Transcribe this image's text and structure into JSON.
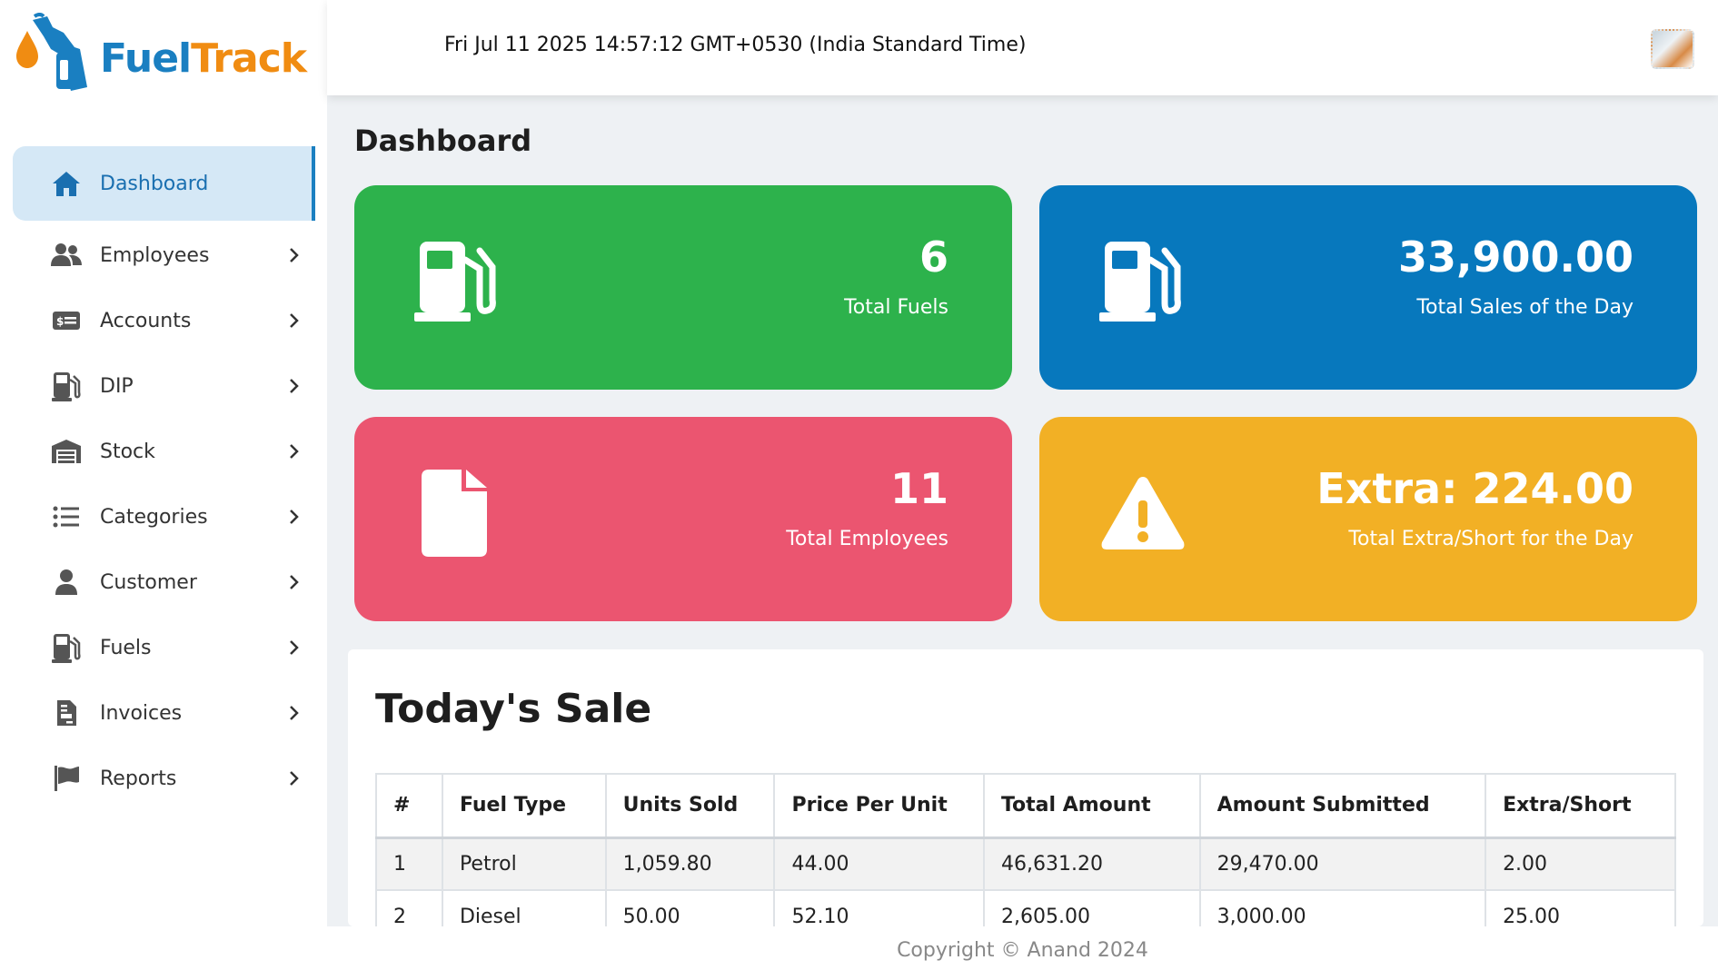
{
  "brand": {
    "part1": "Fuel",
    "part2": "Track"
  },
  "header": {
    "datetime": "Fri Jul 11 2025 14:57:12 GMT+0530 (India Standard Time)",
    "avatar_icon": "user-avatar"
  },
  "sidebar": {
    "items": [
      {
        "label": "Dashboard",
        "icon": "home-icon",
        "active": true
      },
      {
        "label": "Employees",
        "icon": "users-icon"
      },
      {
        "label": "Accounts",
        "icon": "money-bill-icon"
      },
      {
        "label": "DIP",
        "icon": "gas-pump-icon"
      },
      {
        "label": "Stock",
        "icon": "warehouse-icon"
      },
      {
        "label": "Categories",
        "icon": "list-icon"
      },
      {
        "label": "Customer",
        "icon": "user-icon"
      },
      {
        "label": "Fuels",
        "icon": "gas-pump-icon"
      },
      {
        "label": "Invoices",
        "icon": "file-invoice-icon"
      },
      {
        "label": "Reports",
        "icon": "flag-icon"
      }
    ]
  },
  "page": {
    "title": "Dashboard"
  },
  "cards": [
    {
      "value": "6",
      "label": "Total Fuels",
      "color": "#2db24c",
      "icon": "gas-pump-icon"
    },
    {
      "value": "33,900.00",
      "label": "Total Sales of the Day",
      "color": "#0778bd",
      "icon": "gas-pump-icon"
    },
    {
      "value": "11",
      "label": "Total Employees",
      "color": "#eb5570",
      "icon": "file-icon"
    },
    {
      "value": "Extra: 224.00",
      "label": "Total Extra/Short for the Day",
      "color": "#f2b025",
      "icon": "warning-icon"
    }
  ],
  "sale": {
    "title": "Today's Sale",
    "columns": [
      "#",
      "Fuel Type",
      "Units Sold",
      "Price Per Unit",
      "Total Amount",
      "Amount Submitted",
      "Extra/Short"
    ],
    "rows": [
      [
        "1",
        "Petrol",
        "1,059.80",
        "44.00",
        "46,631.20",
        "29,470.00",
        "2.00"
      ],
      [
        "2",
        "Diesel",
        "50.00",
        "52.10",
        "2,605.00",
        "3,000.00",
        "25.00"
      ]
    ]
  },
  "footer": {
    "text": "Copyright © Anand 2024"
  }
}
